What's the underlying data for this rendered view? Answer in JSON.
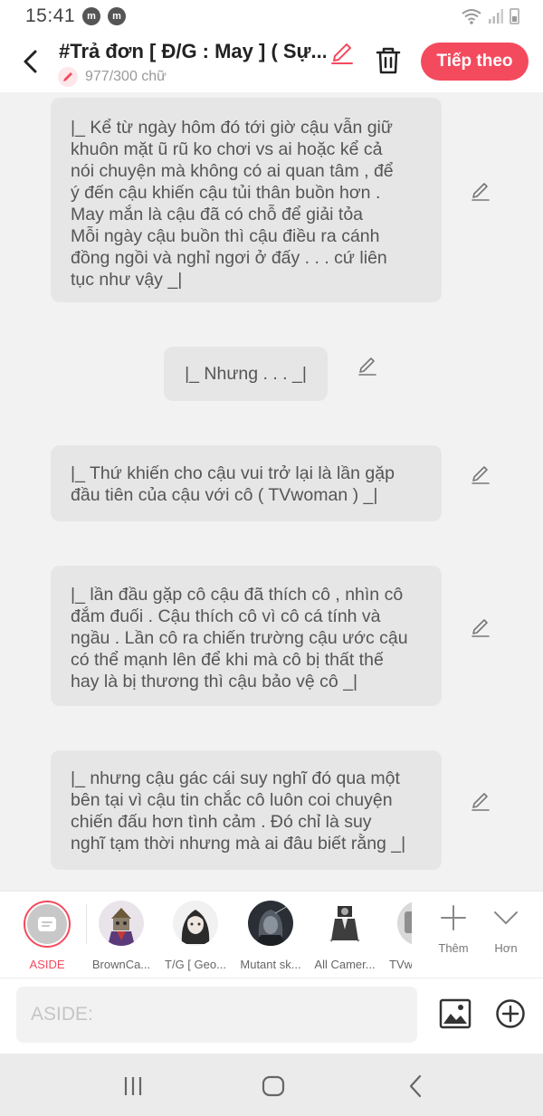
{
  "status_bar": {
    "time": "15:41",
    "notification_icons": [
      "m",
      "m"
    ]
  },
  "header": {
    "title": "#Trả đơn [ Đ/G : May ] ( Sự...",
    "word_count": "977/300 chữ",
    "next_button": "Tiếp theo",
    "accent_color": "#f44a5e"
  },
  "messages": [
    {
      "lines": [
        "|_ Kể từ ngày hôm đó tới giờ cậu vẫn giữ",
        "khuôn mặt ũ rũ ko chơi vs ai hoặc kể cả",
        "nói chuyện mà không có ai quan tâm , để",
        "ý đến cậu khiến cậu tủi thân buồn hơn .",
        "May mắn là cậu đã có chỗ để giải tỏa",
        "Mỗi ngày cậu buồn thì cậu điều ra cánh",
        "đồng ngồi và nghỉ ngơi ở đấy . . . cứ liên",
        "tục như vậy _|"
      ]
    },
    {
      "lines": [
        "|_ Nhưng . . . _|"
      ]
    },
    {
      "lines": [
        "|_ Thứ khiến cho cậu vui trở lại là lần gặp",
        "đầu tiên của cậu với cô ( TVwoman ) _|"
      ]
    },
    {
      "lines": [
        "|_ lần đầu gặp cô cậu đã thích cô , nhìn cô",
        "đắm đuối . Cậu thích cô vì cô cá tính và",
        "ngầu . Lần cô ra chiến trường cậu ước cậu",
        "có thể mạnh lên để khi mà cô bị thất thế",
        "hay là bị thương thì cậu bảo vệ cô _|"
      ]
    },
    {
      "lines": [
        "|_ nhưng cậu gác cái suy nghĩ đó qua một",
        "bên tại vì cậu tin chắc cô luôn coi chuyện",
        "chiến đấu hơn tình cảm . Đó chỉ là suy",
        "nghĩ tạm thời nhưng mà ai đâu biết rằng _|"
      ]
    }
  ],
  "characters": [
    {
      "name": "ASIDE",
      "selected": true
    },
    {
      "name": "BrownCa..."
    },
    {
      "name": "T/G [ Geo..."
    },
    {
      "name": "Mutant sk..."
    },
    {
      "name": "All Camer..."
    },
    {
      "name": "TVw"
    }
  ],
  "tools": {
    "add_label": "Thêm",
    "more_label": "Hơn"
  },
  "input": {
    "placeholder": "ASIDE:"
  }
}
